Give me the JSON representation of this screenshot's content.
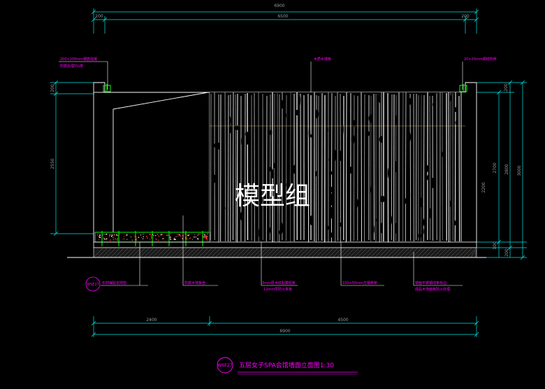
{
  "dimensions": {
    "top_total": "6900",
    "top_left": "200",
    "top_mid": "6500",
    "top_right": "200",
    "left_top": "200",
    "left_main": "2550",
    "right_top": "200",
    "right_main": "2700",
    "right_mid": "2800",
    "right_total": "3000",
    "right_bottom": "100",
    "right_bottom2": "200",
    "bottom_left": "2400",
    "bottom_right": "4500",
    "bottom_total": "6900",
    "inner_height": "2200"
  },
  "annotations": {
    "top_left_1": "200×200mm钢筋混凝",
    "top_left_2": "防腐处理5%楼",
    "top_center": "木质水墙板",
    "top_right": "20×20mm钢结构骨",
    "bottom_1": "石材铺贴花岗岩",
    "bottom_2": "防腐木地板坐",
    "bottom_3a": "3mm厚木纹贴膜铝板",
    "bottom_3b": "12mm厚防火夹板",
    "bottom_4": "100×50mm方钢骨架",
    "bottom_5a": "镜面不锈钢线条收边",
    "bottom_5b": "成品木饰面板防火处理"
  },
  "callout_left": "WSE27",
  "watermark": "模型组",
  "title": {
    "tag": "WSE27",
    "text": "五层女子SPA会馆墙面立面图1:30"
  },
  "colors": {
    "background": "#000000",
    "dimension": "#00ffff",
    "annotation": "#ff00ff",
    "outline": "#ffffff",
    "grass": "#00ff00",
    "gravel": "#ff3030"
  }
}
